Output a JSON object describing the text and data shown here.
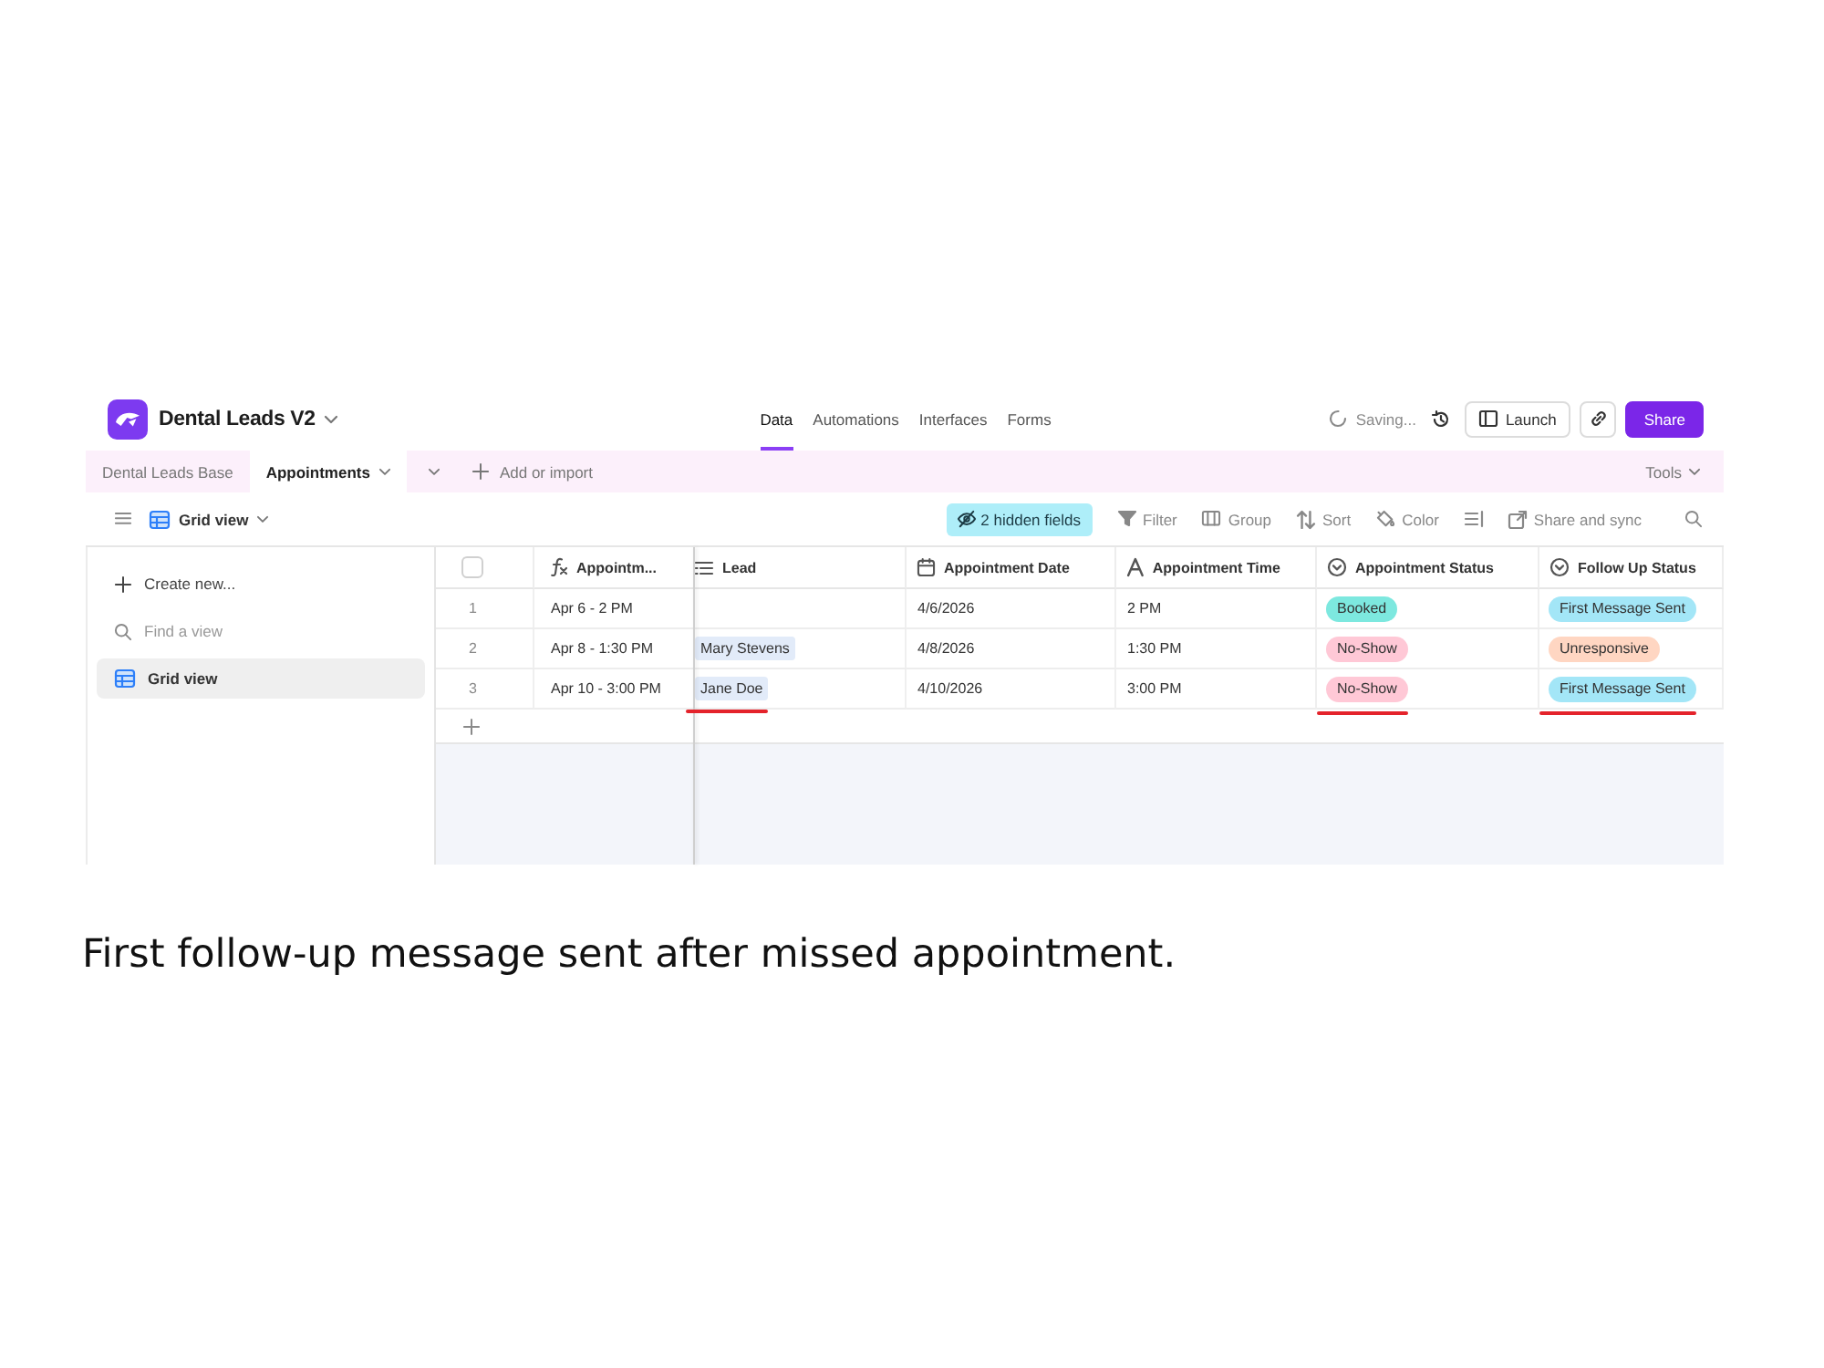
{
  "app_bar": {
    "title": "Dental Leads V2",
    "nav": [
      {
        "label": "Data",
        "selected": true
      },
      {
        "label": "Automations",
        "selected": false
      },
      {
        "label": "Interfaces",
        "selected": false
      },
      {
        "label": "Forms",
        "selected": false
      }
    ],
    "save_status": "Saving...",
    "launch_label": "Launch",
    "share_label": "Share"
  },
  "table_tabs": {
    "tabs": [
      {
        "label": "Dental Leads Base",
        "selected": false
      },
      {
        "label": "Appointments",
        "selected": true
      }
    ],
    "add_label": "Add or import",
    "tools_label": "Tools"
  },
  "view_bar": {
    "view_label": "Grid view",
    "hidden_fields": "2 hidden fields",
    "actions": [
      {
        "kind": "filter",
        "label": "Filter"
      },
      {
        "kind": "group",
        "label": "Group"
      },
      {
        "kind": "sort",
        "label": "Sort"
      },
      {
        "kind": "color",
        "label": "Color"
      },
      {
        "kind": "row_height"
      },
      {
        "kind": "share",
        "label": "Share and sync"
      }
    ]
  },
  "sidebar": {
    "create_label": "Create new...",
    "search": {
      "placeholder": "Find a view"
    },
    "views": [
      {
        "label": "Grid view",
        "selected": true
      }
    ]
  },
  "table": {
    "select_all": {
      "checked": false
    },
    "columns": [
      {
        "label": "Appointm...",
        "kind": "formula"
      },
      {
        "label": "Lead",
        "kind": "link"
      },
      {
        "label": "Appointment Date",
        "kind": "date"
      },
      {
        "label": "Appointment Time",
        "kind": "text"
      },
      {
        "label": "Appointment Status",
        "kind": "select"
      },
      {
        "label": "Follow Up Status",
        "kind": "select"
      }
    ],
    "rows": [
      {
        "number": "1",
        "cells": [
          {
            "text": "Apr 6 - 2 PM",
            "underlined": false
          },
          null,
          {
            "text": "4/6/2026",
            "underlined": false
          },
          {
            "text": "2 PM",
            "underlined": false
          },
          {
            "text": "Booked",
            "color": "#7de8df",
            "underlined": false
          },
          {
            "text": "First Message Sent",
            "color": "#a3e6f7",
            "underlined": false
          }
        ]
      },
      {
        "number": "2",
        "cells": [
          {
            "text": "Apr 8 - 1:30 PM",
            "underlined": false
          },
          {
            "text": "Mary Stevens",
            "underlined": false
          },
          {
            "text": "4/8/2026",
            "underlined": false
          },
          {
            "text": "1:30 PM",
            "underlined": false
          },
          {
            "text": "No-Show",
            "color": "#ffc8d6",
            "underlined": false
          },
          {
            "text": "Unresponsive",
            "color": "#ffd6c2",
            "underlined": false
          }
        ]
      },
      {
        "number": "3",
        "cells": [
          {
            "text": "Apr 10 - 3:00 PM",
            "underlined": false
          },
          {
            "text": "Jane Doe",
            "underlined": true
          },
          {
            "text": "4/10/2026",
            "underlined": false
          },
          {
            "text": "3:00 PM",
            "underlined": false
          },
          {
            "text": "No-Show",
            "color": "#ffc8d6",
            "underlined": true
          },
          {
            "text": "First Message Sent",
            "color": "#a3e6f7",
            "underlined": true
          }
        ]
      }
    ]
  },
  "caption": "First follow-up message sent after missed appointment."
}
